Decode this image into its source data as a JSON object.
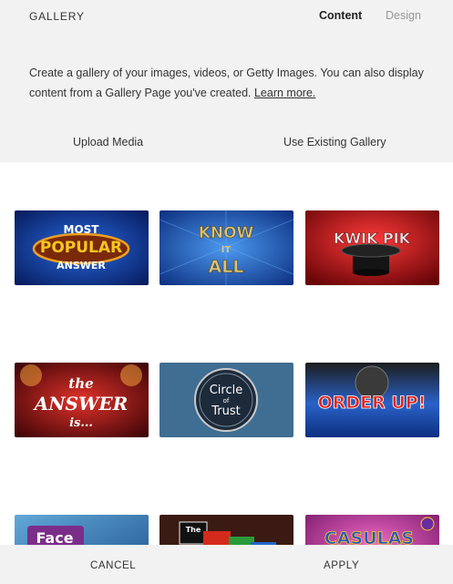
{
  "header": {
    "title": "GALLERY",
    "tabs": [
      {
        "label": "Content",
        "active": true
      },
      {
        "label": "Design",
        "active": false
      }
    ]
  },
  "description": {
    "text": "Create a gallery of your images, videos, or Getty Images. You can also display content from a Gallery Page you've created.",
    "link_label": "Learn more."
  },
  "actions": {
    "upload": "Upload Media",
    "existing": "Use Existing Gallery"
  },
  "gallery": {
    "items": [
      {
        "lines": [
          "MOST",
          "POPULAR",
          "ANSWER"
        ],
        "bg": "#0b2f8a",
        "accent": "#f7c620"
      },
      {
        "lines": [
          "KNOW",
          "IT",
          "ALL"
        ],
        "bg": "#1d55b8",
        "accent": "#d9c27a"
      },
      {
        "lines": [
          "KWIK PIK"
        ],
        "bg": "#b2141e",
        "accent": "#e0e0e0"
      },
      {
        "lines": [
          "the",
          "ANSWER",
          "is..."
        ],
        "bg": "#8c0e12",
        "accent": "#ffffff"
      },
      {
        "lines": [
          "Circle",
          "of",
          "Trust"
        ],
        "bg": "#3f6e92",
        "accent": "#ffffff"
      },
      {
        "lines": [
          "ORDER UP!"
        ],
        "bg": "#1a46a8",
        "accent": "#e2241b"
      },
      {
        "lines": [
          "Face"
        ],
        "bg": "#2b6fa8",
        "accent": "#ffffff"
      },
      {
        "lines": [
          "The"
        ],
        "bg": "#3a1a12",
        "accent": "#ffffff"
      },
      {
        "lines": [
          "CASULAS"
        ],
        "bg": "#c43a9a",
        "accent": "#f3d21a"
      }
    ]
  },
  "footer": {
    "cancel": "CANCEL",
    "apply": "APPLY"
  }
}
